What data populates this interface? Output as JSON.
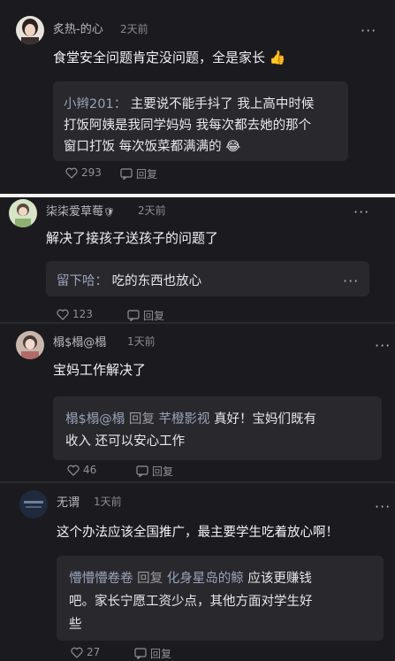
{
  "more_label": "···",
  "c1": {
    "username": "炙热-的心",
    "time": "2天前",
    "text": "食堂安全问题肯定没问题，全是家长",
    "emoji": "👍",
    "reply": {
      "author": "小辫201",
      "sep": "：",
      "line1": "主要说不能手抖了 我上高中时候",
      "line2": "打饭阿姨是我同学妈妈 我每次都去她的那个",
      "line3": "窗口打饭 每次饭菜都满满的",
      "emoji": "😂"
    },
    "likes": "293",
    "reply_label": "回复"
  },
  "c2": {
    "username": "柒柒爱草莓",
    "badge": "🛡",
    "time": "2天前",
    "text": "解决了接孩子送孩子的问题了",
    "reply": {
      "author": "留下哈",
      "sep": "：",
      "line1": "吃的东西也放心"
    },
    "likes": "123",
    "reply_label": "回复"
  },
  "c3": {
    "username": "榻$榻@榻",
    "time": "1天前",
    "text": "宝妈工作解决了",
    "reply": {
      "author": "榻$榻@榻",
      "tag": "回复",
      "target": "芊橙影视",
      "line1": "真好！宝妈们既有",
      "line2": "收入 还可以安心工作"
    },
    "likes": "46",
    "reply_label": "回复"
  },
  "c4": {
    "username": "无谓",
    "time": "1天前",
    "text": "这个办法应该全国推广，最主要学生吃着放心啊！",
    "reply": {
      "author": "懵懵懵卷卷",
      "tag": "回复",
      "target": "化身星岛的鲸",
      "line1": "应该更赚钱",
      "line2": "吧。家长宁愿工资少点，其他方面对学生好",
      "line3": "些"
    },
    "likes": "27",
    "reply_label": "回复"
  },
  "colors": {
    "background": "#1b1b1f",
    "reply_box": "#28282d",
    "username": "#b9b9c0",
    "reply_author": "#9aa3b8",
    "seam": "#f4f4f4"
  }
}
